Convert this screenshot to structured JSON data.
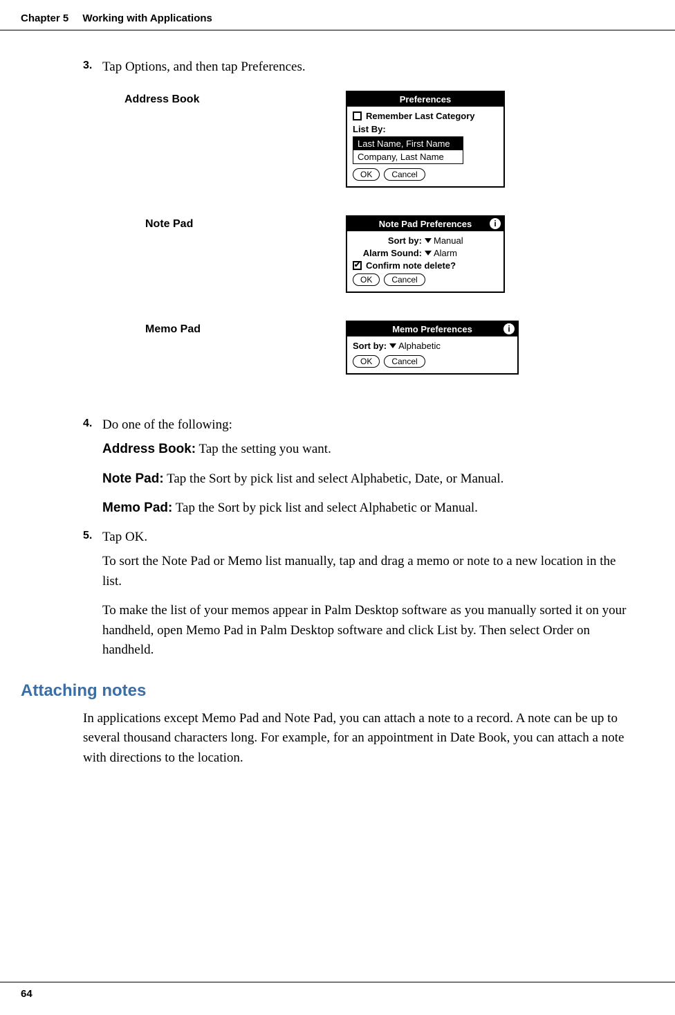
{
  "header": {
    "chapter": "Chapter 5",
    "title": "Working with Applications"
  },
  "steps": {
    "s3": {
      "num": "3.",
      "text": "Tap Options, and then tap Preferences."
    },
    "s4": {
      "num": "4.",
      "intro": "Do one of the following:",
      "address_label": "Address Book:",
      "address_text": " Tap the setting you want.",
      "note_label": "Note Pad:",
      "note_text": " Tap the Sort by pick list and select Alphabetic, Date, or Manual.",
      "memo_label": "Memo Pad:",
      "memo_text": " Tap the Sort by pick list and select Alphabetic or Manual."
    },
    "s5": {
      "num": "5.",
      "text": "Tap OK.",
      "p1": "To sort the Note Pad or Memo list manually, tap and drag a memo or note to a new location in the list.",
      "p2": "To make the list of your memos appear in Palm Desktop software as you manually sorted it on your handheld, open Memo Pad in Palm Desktop software and click List by. Then select Order on handheld."
    }
  },
  "figures": {
    "address": {
      "caption": "Address Book",
      "title": "Preferences",
      "remember": "Remember Last Category",
      "listby": "List By:",
      "opt1": "Last Name, First Name",
      "opt2": "Company, Last Name",
      "ok": "OK",
      "cancel": "Cancel"
    },
    "notepad": {
      "caption": "Note Pad",
      "title": "Note Pad Preferences",
      "sortby_k": "Sort by:",
      "sortby_v": "Manual",
      "alarm_k": "Alarm Sound:",
      "alarm_v": "Alarm",
      "confirm": "Confirm note delete?",
      "ok": "OK",
      "cancel": "Cancel"
    },
    "memopad": {
      "caption": "Memo Pad",
      "title": "Memo Preferences",
      "sortby_k": "Sort by:",
      "sortby_v": "Alphabetic",
      "ok": "OK",
      "cancel": "Cancel"
    }
  },
  "section": {
    "heading": "Attaching notes",
    "para": "In applications except Memo Pad and Note Pad, you can attach a note to a record. A note can be up to several thousand characters long. For example, for an appointment in Date Book, you can attach a note with directions to the location."
  },
  "footer": {
    "page": "64"
  }
}
